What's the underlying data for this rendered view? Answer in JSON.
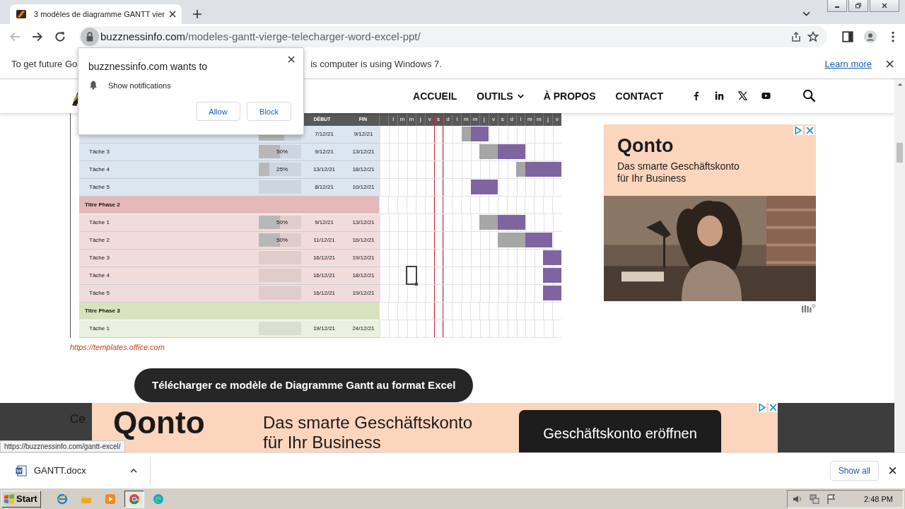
{
  "browser": {
    "tab": {
      "title": "3 modèles de diagramme GANTT vier"
    },
    "url": {
      "host": "buzznessinfo.com",
      "path": "/modeles-gantt-vierge-telecharger-word-excel-ppt/"
    }
  },
  "infobar": {
    "text_before": "To get future Go",
    "text_after": "is computer is using Windows 7.",
    "link": "Learn more"
  },
  "popup": {
    "title": "buzznessinfo.com wants to",
    "permission": "Show notifications",
    "buttons": [
      "Allow",
      "Block"
    ]
  },
  "nav": {
    "items": [
      {
        "label": "ACCUEIL",
        "dropdown": false
      },
      {
        "label": "OUTILS",
        "dropdown": true
      },
      {
        "label": "À PROPOS",
        "dropdown": false
      },
      {
        "label": "CONTACT",
        "dropdown": false
      }
    ]
  },
  "gantt": {
    "start_heading": "DÉBUT",
    "end_heading": "FIN",
    "days": [
      {
        "label": "l",
        "today": false
      },
      {
        "label": "m",
        "today": false
      },
      {
        "label": "m",
        "today": false
      },
      {
        "label": "j",
        "today": false
      },
      {
        "label": "v",
        "today": false
      },
      {
        "label": "s",
        "today": true
      },
      {
        "label": "d",
        "today": false
      },
      {
        "label": "l",
        "today": false
      },
      {
        "label": "m",
        "today": false
      },
      {
        "label": "m",
        "today": false
      },
      {
        "label": "j",
        "today": false
      },
      {
        "label": "v",
        "today": false
      },
      {
        "label": "s",
        "today": false
      },
      {
        "label": "d",
        "today": false
      },
      {
        "label": "l",
        "today": false
      },
      {
        "label": "m",
        "today": false
      },
      {
        "label": "m",
        "today": false
      },
      {
        "label": "j",
        "today": false
      },
      {
        "label": "v",
        "today": false
      }
    ],
    "phases": [
      {
        "color": "#dce6f1",
        "tasks": [
          {
            "level": 0.6,
            "start": "7/12/21",
            "end": "9/12/21"
          },
          {
            "name": "Tâche 3",
            "percent": "50%",
            "level": 0.5,
            "start": "9/12/21",
            "end": "13/12/21"
          },
          {
            "name": "Tâche 4",
            "percent": "25%",
            "level": 0.25,
            "start": "13/12/21",
            "end": "18/12/21"
          },
          {
            "name": "Tâche 5",
            "start": "8/12/21",
            "end": "10/12/21"
          }
        ]
      },
      {
        "title": "Titre Phase 2",
        "color": "#f2dcdb",
        "tasks": [
          {
            "name": "Tâche 1",
            "percent": "50%",
            "level": 0.5,
            "start": "9/12/21",
            "end": "13/12/21"
          },
          {
            "name": "Tâche 2",
            "percent": "50%",
            "level": 0.5,
            "start": "11/12/21",
            "end": "16/12/21"
          },
          {
            "name": "Tâche 3",
            "start": "16/12/21",
            "end": "19/12/21"
          },
          {
            "name": "Tâche 4",
            "start": "16/12/21",
            "end": "18/12/21"
          },
          {
            "name": "Tâche 5",
            "start": "16/12/21",
            "end": "19/12/21"
          }
        ]
      },
      {
        "title": "Titre Phase 3",
        "color": "#ebf1de",
        "tasks": [
          {
            "name": "Tâche 1",
            "start": "19/12/21",
            "end": "24/12/21"
          }
        ]
      }
    ]
  },
  "source_link": "https://templates.office.com",
  "download_button": "Télécharger ce modèle de Diagramme Gantt au format Excel",
  "paragraph_start": "Ce",
  "side_ad": {
    "brand": "Qonto",
    "text": "Das smarte Geschäftskonto für Ihr Business",
    "kind": "picture"
  },
  "bottom_ad": {
    "brand": "Qonto",
    "text": "Das smarte Geschäftskonto für Ihr Business",
    "button": "Geschäftskonto eröffnen"
  },
  "status_url": "https://buzznessinfo.com/gantt-excel/",
  "downloads": {
    "file": "GANTT.docx",
    "show_all": "Show all"
  },
  "taskbar": {
    "start": "Start",
    "clock": "2:48 PM",
    "apps": [
      {
        "kind": "ie",
        "selected": false
      },
      {
        "kind": "explorer",
        "selected": false
      },
      {
        "kind": "media",
        "selected": false
      },
      {
        "kind": "chrome",
        "selected": true
      },
      {
        "kind": "edge",
        "selected": false
      }
    ]
  }
}
